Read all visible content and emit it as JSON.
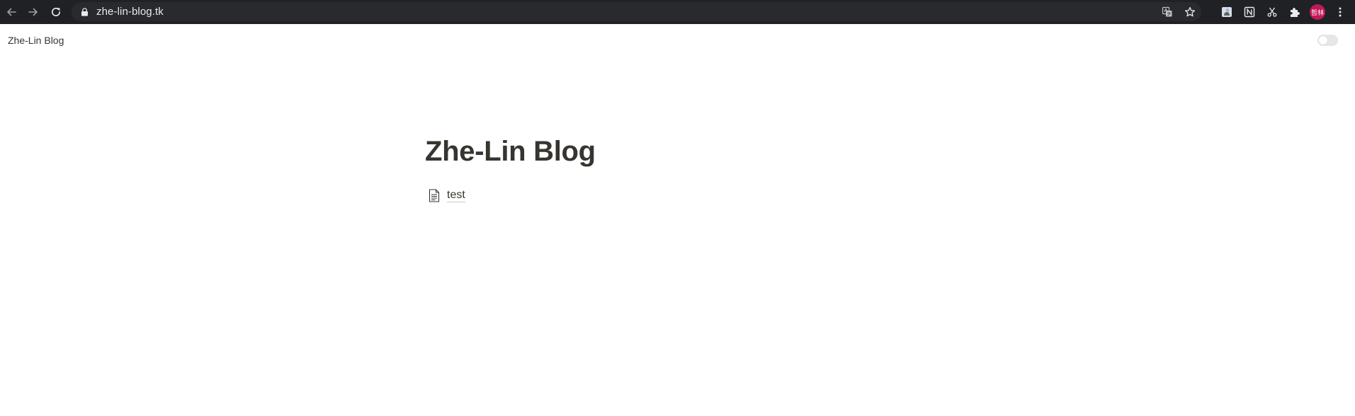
{
  "browser": {
    "url": "zhe-lin-blog.tk",
    "profile_avatar_text": "哲林",
    "colors": {
      "chrome_bg": "#202124",
      "omnibox_bg": "#282a2d",
      "avatar_bg": "#c2185b"
    },
    "omnibox_icons": [
      "translate-icon",
      "bookmark-star-icon"
    ],
    "extension_icons": [
      "extension-app-icon",
      "notion-icon",
      "scissors-icon",
      "extensions-puzzle-icon"
    ]
  },
  "header": {
    "site_name": "Zhe-Lin Blog",
    "theme_toggle_on": false
  },
  "main": {
    "title": "Zhe-Lin Blog",
    "pages": [
      {
        "label": "test",
        "icon": "page-icon"
      }
    ]
  },
  "colors": {
    "text": "#37352f",
    "toggle_bg": "#e6e6e5"
  }
}
